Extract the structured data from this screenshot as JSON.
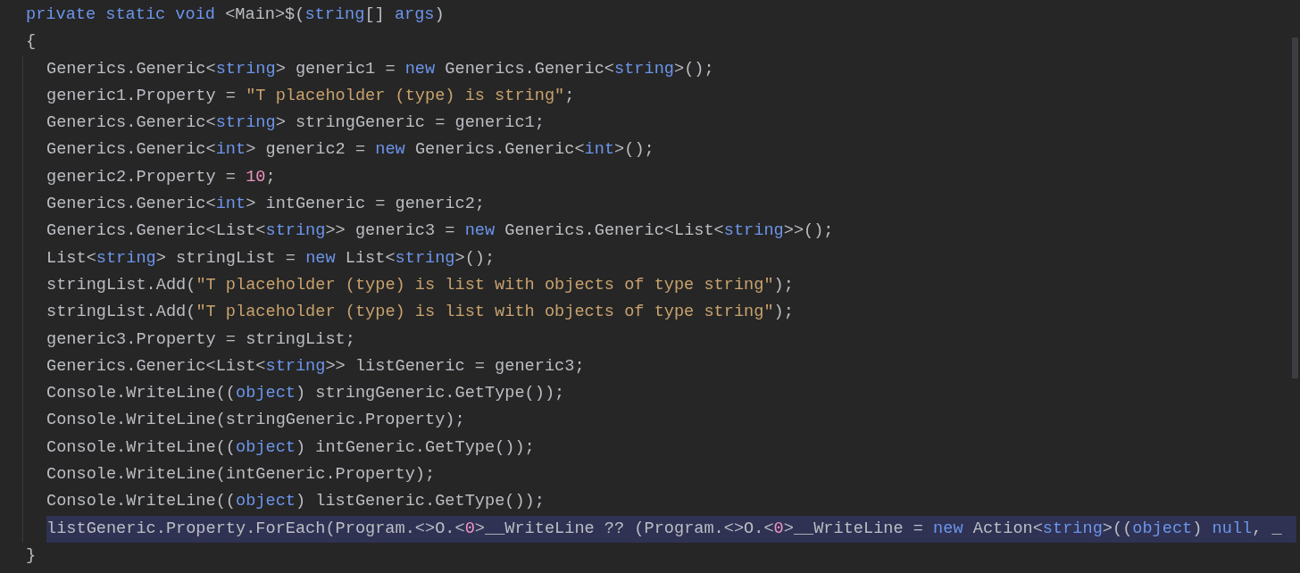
{
  "method": {
    "signature": [
      {
        "kind": "keyword",
        "text": "private static void"
      },
      {
        "kind": "plain",
        "text": " <Main>$("
      },
      {
        "kind": "keyword",
        "text": "string"
      },
      {
        "kind": "plain",
        "text": "[] "
      },
      {
        "kind": "keyword",
        "text": "args"
      },
      {
        "kind": "plain",
        "text": ")"
      }
    ],
    "open_brace": "{",
    "body": [
      {
        "selected": false,
        "tokens": [
          {
            "kind": "plain",
            "text": "Generics.Generic<"
          },
          {
            "kind": "keyword",
            "text": "string"
          },
          {
            "kind": "plain",
            "text": "> generic1 = "
          },
          {
            "kind": "keyword",
            "text": "new"
          },
          {
            "kind": "plain",
            "text": " Generics.Generic<"
          },
          {
            "kind": "keyword",
            "text": "string"
          },
          {
            "kind": "plain",
            "text": ">();"
          }
        ]
      },
      {
        "selected": false,
        "tokens": [
          {
            "kind": "plain",
            "text": "generic1.Property = "
          },
          {
            "kind": "string",
            "text": "\"T placeholder (type) is string\""
          },
          {
            "kind": "plain",
            "text": ";"
          }
        ]
      },
      {
        "selected": false,
        "tokens": [
          {
            "kind": "plain",
            "text": "Generics.Generic<"
          },
          {
            "kind": "keyword",
            "text": "string"
          },
          {
            "kind": "plain",
            "text": "> stringGeneric = generic1;"
          }
        ]
      },
      {
        "selected": false,
        "tokens": [
          {
            "kind": "plain",
            "text": "Generics.Generic<"
          },
          {
            "kind": "keyword",
            "text": "int"
          },
          {
            "kind": "plain",
            "text": "> generic2 = "
          },
          {
            "kind": "keyword",
            "text": "new"
          },
          {
            "kind": "plain",
            "text": " Generics.Generic<"
          },
          {
            "kind": "keyword",
            "text": "int"
          },
          {
            "kind": "plain",
            "text": ">();"
          }
        ]
      },
      {
        "selected": false,
        "tokens": [
          {
            "kind": "plain",
            "text": "generic2.Property = "
          },
          {
            "kind": "number",
            "text": "10"
          },
          {
            "kind": "plain",
            "text": ";"
          }
        ]
      },
      {
        "selected": false,
        "tokens": [
          {
            "kind": "plain",
            "text": "Generics.Generic<"
          },
          {
            "kind": "keyword",
            "text": "int"
          },
          {
            "kind": "plain",
            "text": "> intGeneric = generic2;"
          }
        ]
      },
      {
        "selected": false,
        "tokens": [
          {
            "kind": "plain",
            "text": "Generics.Generic<List<"
          },
          {
            "kind": "keyword",
            "text": "string"
          },
          {
            "kind": "plain",
            "text": ">> generic3 = "
          },
          {
            "kind": "keyword",
            "text": "new"
          },
          {
            "kind": "plain",
            "text": " Generics.Generic<List<"
          },
          {
            "kind": "keyword",
            "text": "string"
          },
          {
            "kind": "plain",
            "text": ">>();"
          }
        ]
      },
      {
        "selected": false,
        "tokens": [
          {
            "kind": "plain",
            "text": "List<"
          },
          {
            "kind": "keyword",
            "text": "string"
          },
          {
            "kind": "plain",
            "text": "> stringList = "
          },
          {
            "kind": "keyword",
            "text": "new"
          },
          {
            "kind": "plain",
            "text": " List<"
          },
          {
            "kind": "keyword",
            "text": "string"
          },
          {
            "kind": "plain",
            "text": ">();"
          }
        ]
      },
      {
        "selected": false,
        "tokens": [
          {
            "kind": "plain",
            "text": "stringList.Add("
          },
          {
            "kind": "string",
            "text": "\"T placeholder (type) is list with objects of type string\""
          },
          {
            "kind": "plain",
            "text": ");"
          }
        ]
      },
      {
        "selected": false,
        "tokens": [
          {
            "kind": "plain",
            "text": "stringList.Add("
          },
          {
            "kind": "string",
            "text": "\"T placeholder (type) is list with objects of type string\""
          },
          {
            "kind": "plain",
            "text": ");"
          }
        ]
      },
      {
        "selected": false,
        "tokens": [
          {
            "kind": "plain",
            "text": "generic3.Property = stringList;"
          }
        ]
      },
      {
        "selected": false,
        "tokens": [
          {
            "kind": "plain",
            "text": "Generics.Generic<List<"
          },
          {
            "kind": "keyword",
            "text": "string"
          },
          {
            "kind": "plain",
            "text": ">> listGeneric = generic3;"
          }
        ]
      },
      {
        "selected": false,
        "tokens": [
          {
            "kind": "plain",
            "text": "Console.WriteLine(("
          },
          {
            "kind": "keyword",
            "text": "object"
          },
          {
            "kind": "plain",
            "text": ") stringGeneric.GetType());"
          }
        ]
      },
      {
        "selected": false,
        "tokens": [
          {
            "kind": "plain",
            "text": "Console.WriteLine(stringGeneric.Property);"
          }
        ]
      },
      {
        "selected": false,
        "tokens": [
          {
            "kind": "plain",
            "text": "Console.WriteLine(("
          },
          {
            "kind": "keyword",
            "text": "object"
          },
          {
            "kind": "plain",
            "text": ") intGeneric.GetType());"
          }
        ]
      },
      {
        "selected": false,
        "tokens": [
          {
            "kind": "plain",
            "text": "Console.WriteLine(intGeneric.Property);"
          }
        ]
      },
      {
        "selected": false,
        "tokens": [
          {
            "kind": "plain",
            "text": "Console.WriteLine(("
          },
          {
            "kind": "keyword",
            "text": "object"
          },
          {
            "kind": "plain",
            "text": ") listGeneric.GetType());"
          }
        ]
      },
      {
        "selected": true,
        "tokens": [
          {
            "kind": "plain",
            "text": "listGeneric.Property.ForEach(Program.<>O.<"
          },
          {
            "kind": "number",
            "text": "0"
          },
          {
            "kind": "plain",
            "text": ">__WriteLine ?? (Program.<>O.<"
          },
          {
            "kind": "number",
            "text": "0"
          },
          {
            "kind": "plain",
            "text": ">__WriteLine = "
          },
          {
            "kind": "keyword",
            "text": "new"
          },
          {
            "kind": "plain",
            "text": " Action<"
          },
          {
            "kind": "keyword",
            "text": "string"
          },
          {
            "kind": "plain",
            "text": ">(("
          },
          {
            "kind": "keyword",
            "text": "object"
          },
          {
            "kind": "plain",
            "text": ") "
          },
          {
            "kind": "keyword",
            "text": "null"
          },
          {
            "kind": "plain",
            "text": ", _"
          }
        ]
      }
    ],
    "close_brace": "}"
  }
}
